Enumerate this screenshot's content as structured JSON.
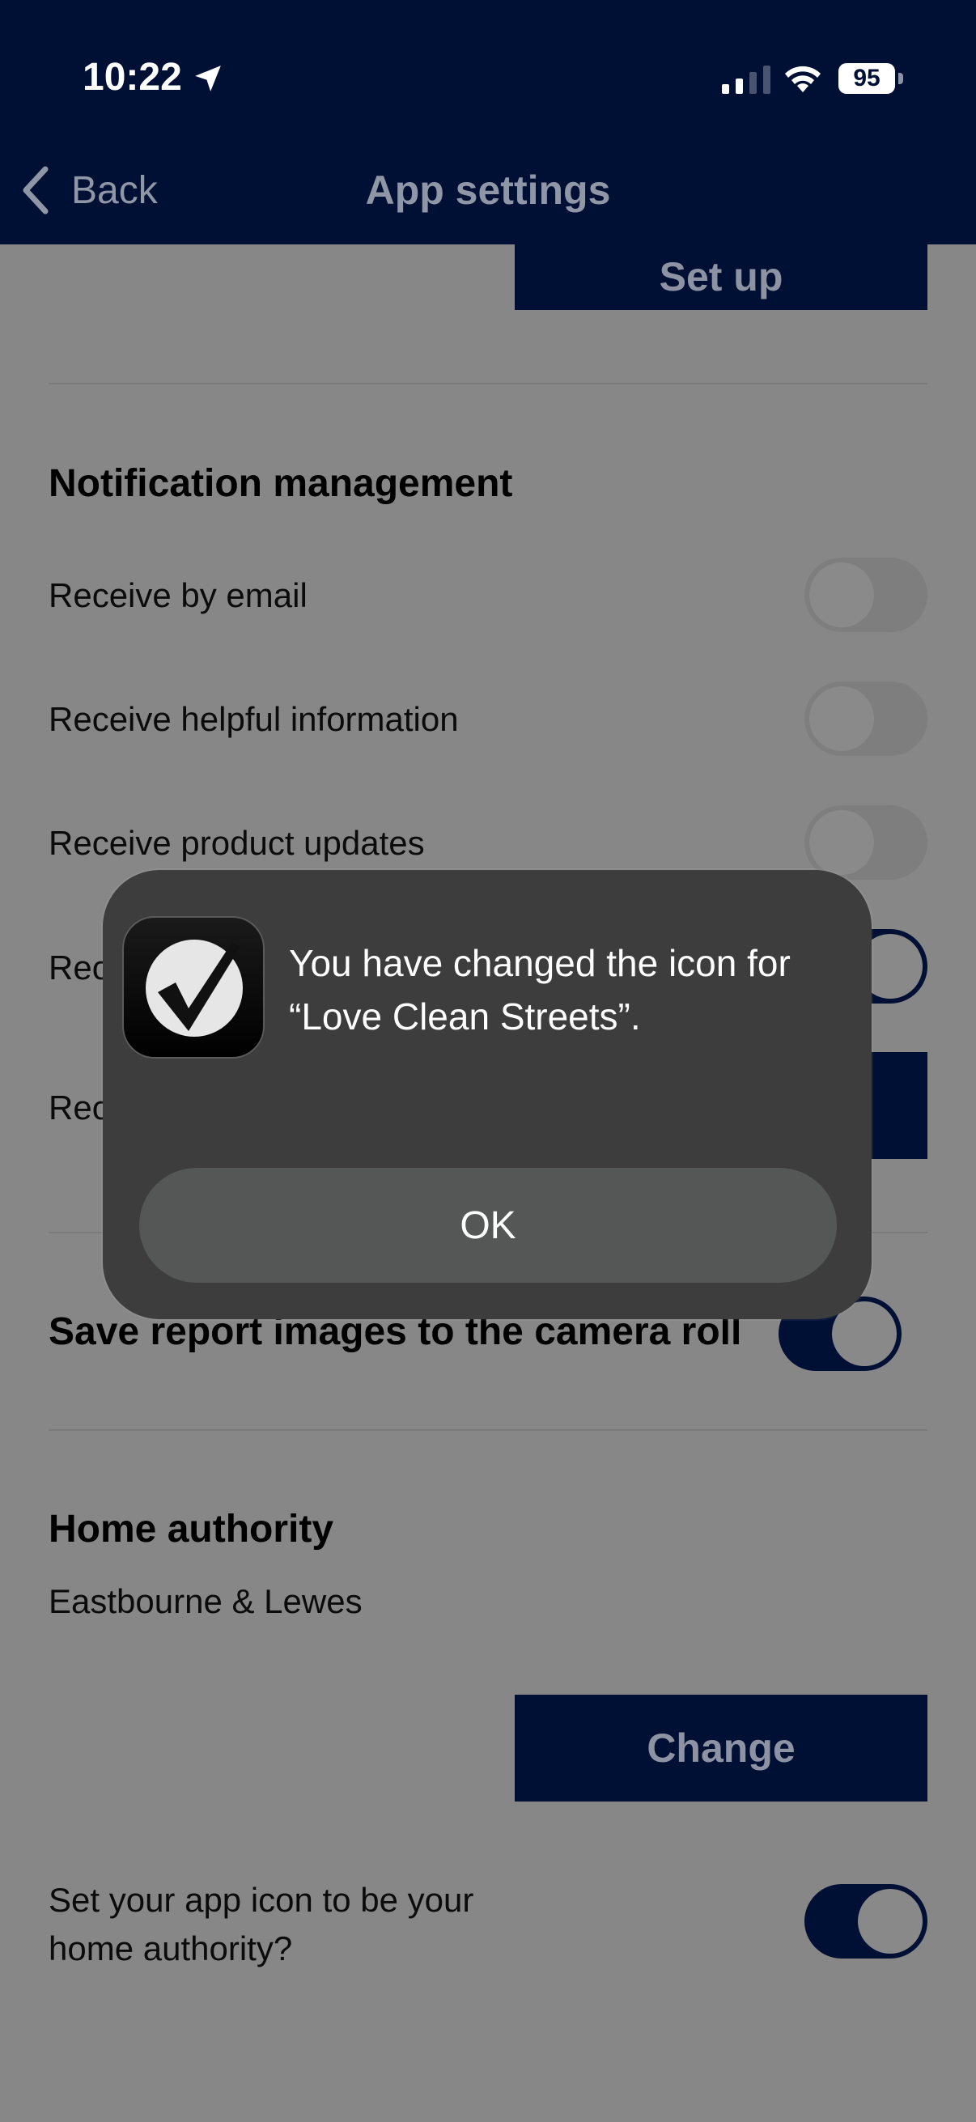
{
  "status_bar": {
    "time": "10:22",
    "battery": "95"
  },
  "nav": {
    "back_label": "Back",
    "title": "App settings"
  },
  "setup_button": "Set up",
  "notifications": {
    "heading": "Notification management",
    "rows": [
      {
        "label": "Receive by email",
        "on": false
      },
      {
        "label": "Receive helpful information",
        "on": false
      },
      {
        "label": "Receive product updates",
        "on": false
      },
      {
        "label": "Rec",
        "on": true
      },
      {
        "label": "Rec"
      }
    ]
  },
  "camera_roll": {
    "label": "Save report images to the camera roll",
    "on": true
  },
  "home_authority": {
    "heading": "Home authority",
    "value": "Eastbourne & Lewes",
    "change_button": "Change",
    "icon_toggle_label": "Set your app icon to be your home authority?",
    "icon_toggle_on": true
  },
  "alert": {
    "message": "You have changed the icon for “Love Clean Streets”.",
    "ok_label": "OK"
  }
}
